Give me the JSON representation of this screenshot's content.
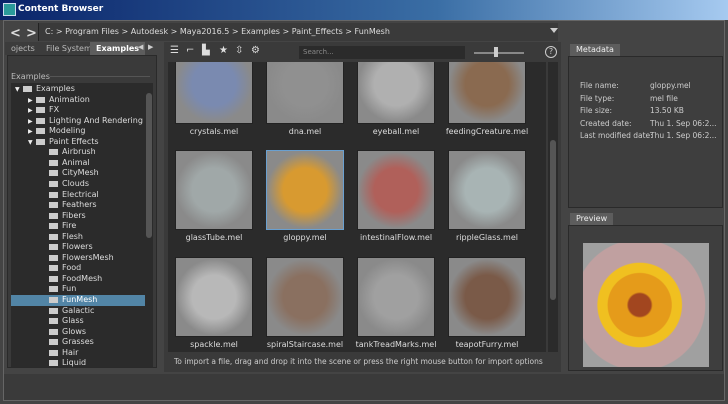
{
  "window": {
    "title": "Content Browser"
  },
  "breadcrumb": "C:  >  Program Files  >  Autodesk  >  Maya2016.5  >  Examples  >  Paint_Effects  >  FunMesh",
  "tabs": [
    "ojects",
    "File System",
    "Examples"
  ],
  "tree": {
    "header": "Examples",
    "items": [
      {
        "label": "Examples",
        "level": 0,
        "arrow": "▼"
      },
      {
        "label": "Animation",
        "level": 1,
        "arrow": "▶"
      },
      {
        "label": "FX",
        "level": 1,
        "arrow": "▶"
      },
      {
        "label": "Lighting And Rendering",
        "level": 1,
        "arrow": "▶"
      },
      {
        "label": "Modeling",
        "level": 1,
        "arrow": "▶"
      },
      {
        "label": "Paint Effects",
        "level": 1,
        "arrow": "▼"
      },
      {
        "label": "Airbrush",
        "level": 2
      },
      {
        "label": "Animal",
        "level": 2
      },
      {
        "label": "CityMesh",
        "level": 2
      },
      {
        "label": "Clouds",
        "level": 2
      },
      {
        "label": "Electrical",
        "level": 2
      },
      {
        "label": "Feathers",
        "level": 2
      },
      {
        "label": "Fibers",
        "level": 2
      },
      {
        "label": "Fire",
        "level": 2
      },
      {
        "label": "Flesh",
        "level": 2
      },
      {
        "label": "Flowers",
        "level": 2
      },
      {
        "label": "FlowersMesh",
        "level": 2
      },
      {
        "label": "Food",
        "level": 2
      },
      {
        "label": "FoodMesh",
        "level": 2
      },
      {
        "label": "Fun",
        "level": 2
      },
      {
        "label": "FunMesh",
        "level": 2,
        "selected": true
      },
      {
        "label": "Galactic",
        "level": 2
      },
      {
        "label": "Glass",
        "level": 2
      },
      {
        "label": "Glows",
        "level": 2
      },
      {
        "label": "Grasses",
        "level": 2
      },
      {
        "label": "Hair",
        "level": 2
      },
      {
        "label": "Liquid",
        "level": 2
      }
    ]
  },
  "search": {
    "placeholder": "Search..."
  },
  "zoom_slider": 0.4,
  "files": [
    {
      "name": "crystals.mel",
      "color": "#7a8ab0"
    },
    {
      "name": "dna.mel",
      "color": "#909090"
    },
    {
      "name": "eyeball.mel",
      "color": "#b0b0b0"
    },
    {
      "name": "feedingCreature.mel",
      "color": "#8a6a50"
    },
    {
      "name": "glassTube.mel",
      "color": "#a0a8a8"
    },
    {
      "name": "gloppy.mel",
      "color": "#d89a30",
      "selected": true
    },
    {
      "name": "intestinalFlow.mel",
      "color": "#b0605a"
    },
    {
      "name": "rippleGlass.mel",
      "color": "#a8b4b4"
    },
    {
      "name": "spackle.mel",
      "color": "#b8b8b8"
    },
    {
      "name": "spiralStaircase.mel",
      "color": "#8a7060"
    },
    {
      "name": "tankTreadMarks.mel",
      "color": "#a0a0a0"
    },
    {
      "name": "teapotFurry.mel",
      "color": "#7a5a48"
    }
  ],
  "status": "To import a file, drag and drop it into the scene or press the right mouse button for import options",
  "metadata": {
    "tab": "Metadata",
    "rows": [
      {
        "k": "File name:",
        "v": "gloppy.mel"
      },
      {
        "k": "File type:",
        "v": "mel file"
      },
      {
        "k": "File size:",
        "v": "13.50 KB"
      },
      {
        "k": "Created date:",
        "v": "Thu 1. Sep 06:2..."
      },
      {
        "k": "Last modified date:",
        "v": "Thu 1. Sep 06:2..."
      }
    ]
  },
  "preview": {
    "tab": "Preview"
  }
}
